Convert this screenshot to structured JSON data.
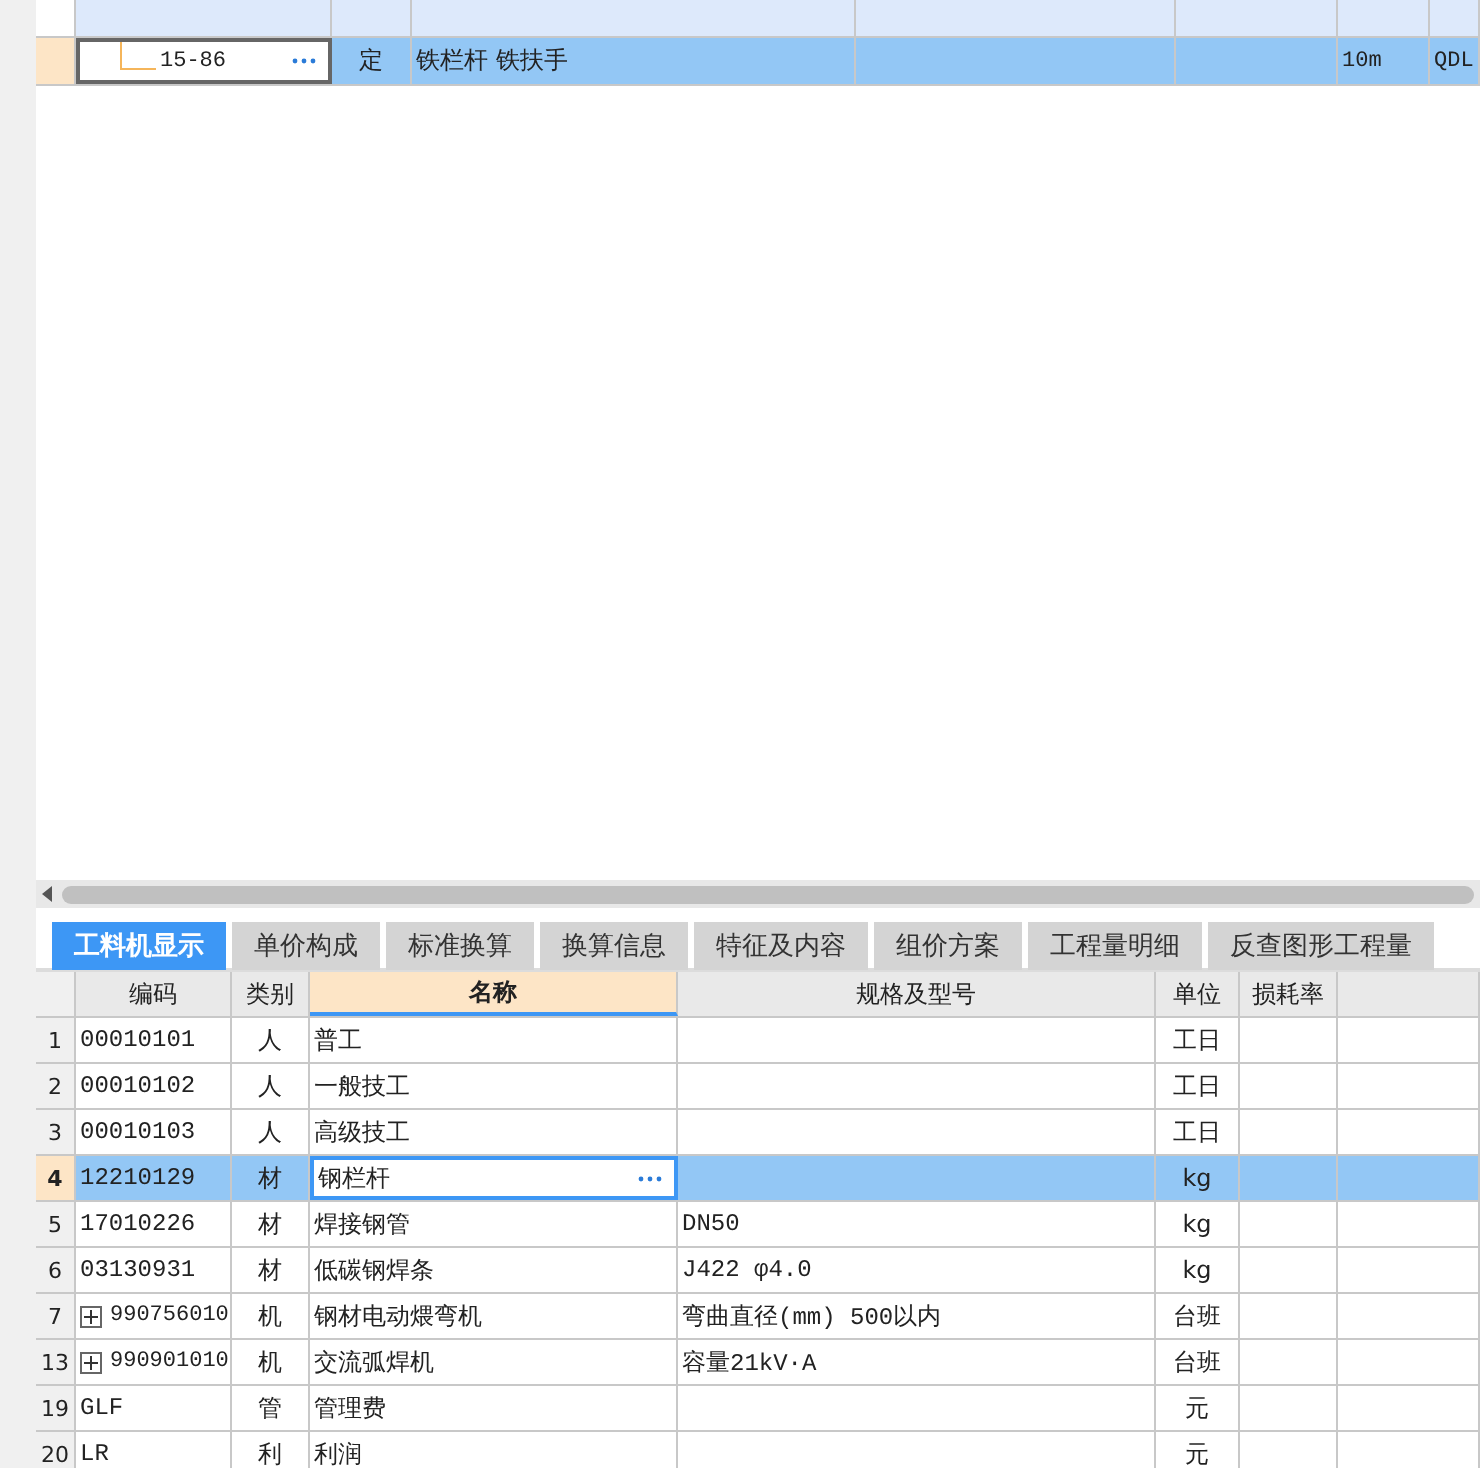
{
  "upper_grid": {
    "rows": [
      {
        "code": "15-86",
        "type": "定",
        "name": "铁栏杆 铁扶手",
        "column_4": "10m",
        "column_5": "QDL",
        "selected": true
      }
    ]
  },
  "tabs": [
    {
      "label": "工料机显示",
      "selected": true
    },
    {
      "label": "单价构成",
      "selected": false
    },
    {
      "label": "标准换算",
      "selected": false
    },
    {
      "label": "换算信息",
      "selected": false
    },
    {
      "label": "特征及内容",
      "selected": false
    },
    {
      "label": "组价方案",
      "selected": false
    },
    {
      "label": "工程量明细",
      "selected": false
    },
    {
      "label": "反查图形工程量",
      "selected": false
    }
  ],
  "resource_table": {
    "columns": [
      "编码",
      "类别",
      "名称",
      "规格及型号",
      "单位",
      "损耗率"
    ],
    "rows": [
      {
        "num": "1",
        "code": "00010101",
        "type": "人",
        "name": "普工",
        "spec": "",
        "unit": "工日",
        "expandable": false,
        "selected": false
      },
      {
        "num": "2",
        "code": "00010102",
        "type": "人",
        "name": "一般技工",
        "spec": "",
        "unit": "工日",
        "expandable": false,
        "selected": false
      },
      {
        "num": "3",
        "code": "00010103",
        "type": "人",
        "name": "高级技工",
        "spec": "",
        "unit": "工日",
        "expandable": false,
        "selected": false
      },
      {
        "num": "4",
        "code": "12210129",
        "type": "材",
        "name": "钢栏杆",
        "spec": "",
        "unit": "kg",
        "expandable": false,
        "selected": true
      },
      {
        "num": "5",
        "code": "17010226",
        "type": "材",
        "name": "焊接钢管",
        "spec": "DN50",
        "unit": "kg",
        "expandable": false,
        "selected": false
      },
      {
        "num": "6",
        "code": "03130931",
        "type": "材",
        "name": "低碳钢焊条",
        "spec": "J422 φ4.0",
        "unit": "kg",
        "expandable": false,
        "selected": false
      },
      {
        "num": "7",
        "code": "990756010",
        "type": "机",
        "name": "钢材电动煨弯机",
        "spec": "弯曲直径(mm) 500以内",
        "unit": "台班",
        "expandable": true,
        "selected": false
      },
      {
        "num": "13",
        "code": "990901010",
        "type": "机",
        "name": "交流弧焊机",
        "spec": "容量21kV·A",
        "unit": "台班",
        "expandable": true,
        "selected": false
      },
      {
        "num": "19",
        "code": "GLF",
        "type": "管",
        "name": "管理费",
        "spec": "",
        "unit": "元",
        "expandable": false,
        "selected": false
      },
      {
        "num": "20",
        "code": "LR",
        "type": "利",
        "name": "利润",
        "spec": "",
        "unit": "元",
        "expandable": false,
        "selected": false
      }
    ]
  }
}
